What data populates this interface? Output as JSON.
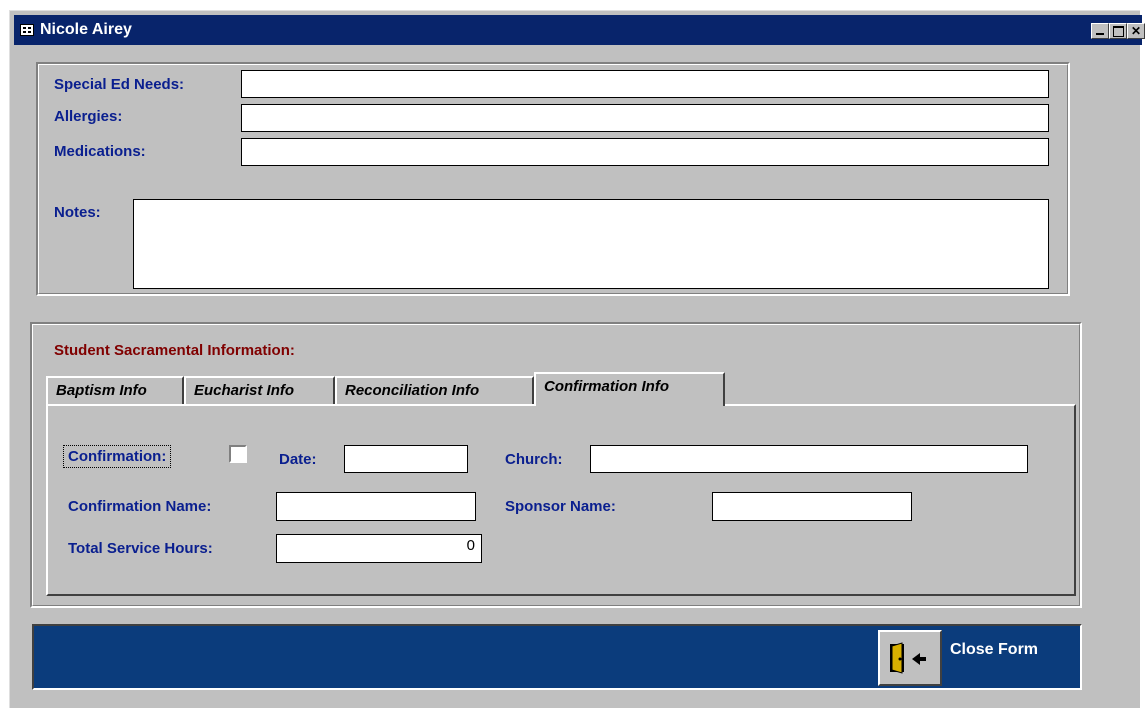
{
  "window": {
    "title": "Nicole Airey"
  },
  "health": {
    "special_ed_label": "Special Ed Needs:",
    "special_ed_value": "",
    "allergies_label": "Allergies:",
    "allergies_value": "",
    "medications_label": "Medications:",
    "medications_value": "",
    "notes_label": "Notes:",
    "notes_value": ""
  },
  "sacrament": {
    "section_title": "Student Sacramental Information:",
    "tabs": [
      {
        "label": "Baptism Info"
      },
      {
        "label": "Eucharist Info"
      },
      {
        "label": "Reconciliation Info"
      },
      {
        "label": "Confirmation Info",
        "active": true
      }
    ],
    "confirmation_label": "Confirmation:",
    "confirmation_checked": false,
    "date_label": "Date:",
    "date_value": "",
    "church_label": "Church:",
    "church_value": "",
    "confirmation_name_label": "Confirmation Name:",
    "confirmation_name_value": "",
    "sponsor_name_label": "Sponsor Name:",
    "sponsor_name_value": "",
    "service_hours_label": "Total Service Hours:",
    "service_hours_value": "0"
  },
  "footer": {
    "close_label": "Close Form"
  },
  "icons": {
    "title": "form-icon",
    "close": "door-exit-icon"
  },
  "colors": {
    "titlebar": "#08246b",
    "label": "#0a1f8f",
    "section_title": "#800000",
    "footer": "#0b3c7c"
  }
}
